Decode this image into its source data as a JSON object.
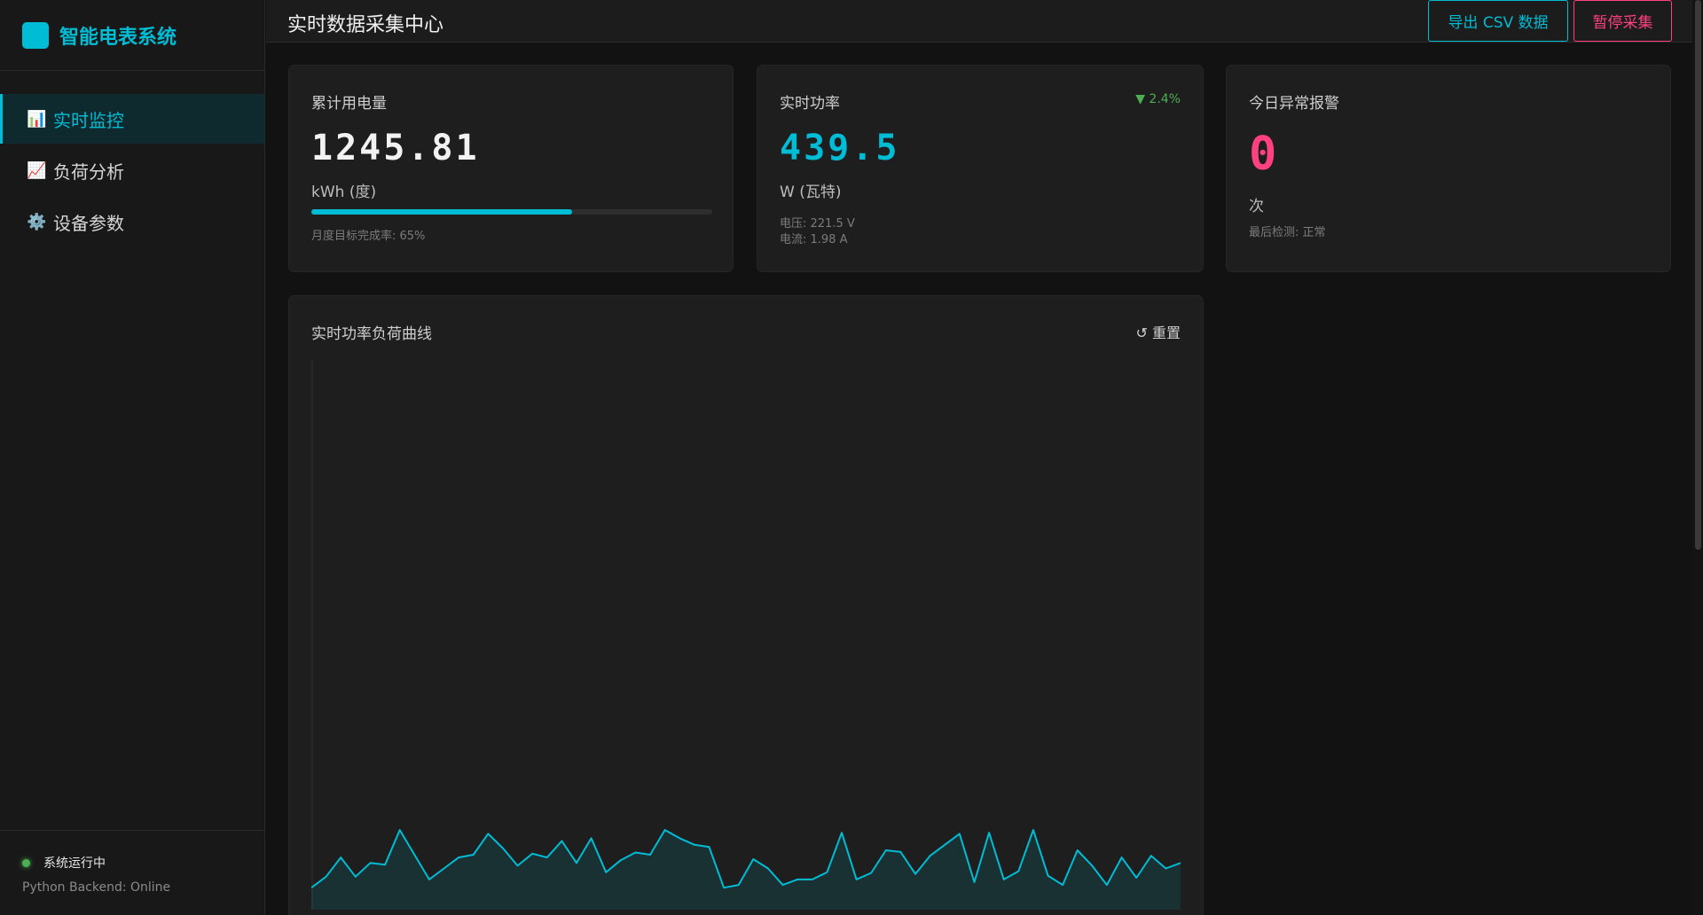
{
  "brand": {
    "title": "智能电表系统"
  },
  "sidebar": {
    "items": [
      {
        "icon": "📊",
        "label": "实时监控",
        "active": true
      },
      {
        "icon": "📈",
        "label": "负荷分析",
        "active": false
      },
      {
        "icon": "⚙️",
        "label": "设备参数",
        "active": false
      }
    ],
    "status": "系统运行中",
    "backend": "Python Backend: Online"
  },
  "header": {
    "title": "实时数据采集中心",
    "export_label": "导出 CSV 数据",
    "pause_label": "暂停采集"
  },
  "cards": {
    "energy": {
      "label": "累计用电量",
      "value": "1245.81",
      "unit": "kWh (度)",
      "progress": 0.65,
      "progress_text": "月度目标完成率: 65%"
    },
    "power": {
      "label": "实时功率",
      "trend": "▼ 2.4%",
      "value": "439.5",
      "unit": "W (瓦特)",
      "voltage": "电压: 221.5 V",
      "current": "电流: 1.98 A"
    },
    "alarm": {
      "label": "今日异常报警",
      "value": "0",
      "unit": "次",
      "last_check": "最后检测: 正常"
    }
  },
  "chart_section": {
    "title": "实时功率负荷曲线",
    "reset_label": "↺ 重置"
  },
  "colors": {
    "accent": "#00bcd4",
    "alert": "#ff4081",
    "ok": "#4caf50"
  },
  "chart_data": {
    "type": "area",
    "title": "",
    "xlabel": "",
    "ylabel": "",
    "ylim": [
      0,
      1000
    ],
    "grid": false,
    "series": [
      {
        "values": [
          40,
          60,
          95,
          60,
          85,
          82,
          145,
          100,
          55,
          75,
          95,
          100,
          138,
          112,
          80,
          102,
          95,
          125,
          85,
          130,
          68,
          90,
          104,
          100,
          145,
          130,
          118,
          114,
          40,
          45,
          92,
          75,
          45,
          55,
          55,
          68,
          140,
          55,
          67,
          108,
          105,
          65,
          98,
          118,
          138,
          50,
          140,
          55,
          70,
          145,
          62,
          45,
          108,
          80,
          45,
          95,
          58,
          98,
          75,
          85
        ]
      }
    ]
  }
}
